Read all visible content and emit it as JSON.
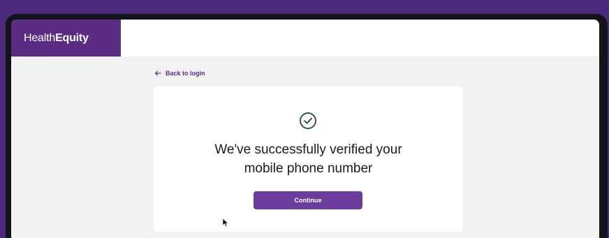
{
  "brand": {
    "name_regular": "Health",
    "name_bold": "Equity",
    "trademark": "·",
    "color": "#5b2c83"
  },
  "nav": {
    "back_label": "Back to login",
    "back_icon": "arrow-left-icon"
  },
  "card": {
    "status_icon": "check-circle-icon",
    "status_color": "#2e5a3c",
    "headline_line1": "We've successfully verified your",
    "headline_line2": "mobile phone number",
    "continue_label": "Continue",
    "button_color": "#6a3d9c"
  }
}
